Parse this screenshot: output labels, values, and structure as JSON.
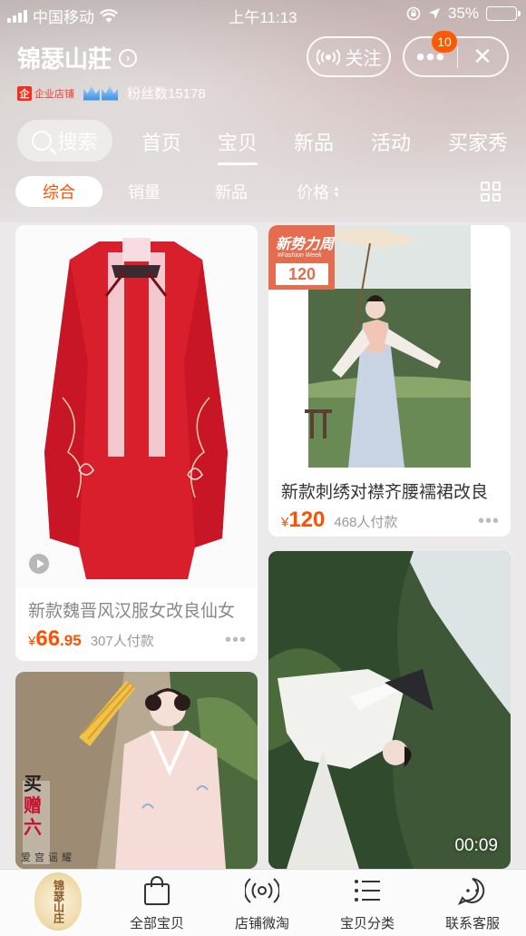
{
  "status_bar": {
    "carrier": "中国移动",
    "time": "上午11:13",
    "battery": "35%",
    "battery_level": 0.35
  },
  "shop": {
    "name": "锦瑟山莊",
    "follow_label": "关注",
    "badge_count": "10",
    "tmall_label": "企业店铺",
    "fans": "粉丝数15178",
    "logo_text": "锦瑟山庄"
  },
  "nav": {
    "search_label": "搜索",
    "tabs": [
      "首页",
      "宝贝",
      "新品",
      "活动",
      "买家秀"
    ],
    "active_tab": "宝贝"
  },
  "filters": {
    "items": [
      "综合",
      "销量",
      "新品",
      "价格"
    ],
    "active": "综合"
  },
  "products": [
    {
      "title": "新款魏晋风汉服女改良仙女",
      "currency": "¥",
      "price_int": "66",
      "price_dec": ".95",
      "sold": "307人付款"
    },
    {
      "title": "新款刺绣对襟齐腰襦裙改良",
      "currency": "¥",
      "price_int": "120",
      "price_dec": "",
      "sold": "468人付款",
      "tag": {
        "line1": "新势力周",
        "line2": "#Fashion Week",
        "price": "120"
      }
    },
    {
      "overlay_lines": [
        "买",
        "赠",
        "六"
      ],
      "side_text": "爱宫谣耀"
    },
    {
      "duration": "00:09"
    }
  ],
  "tabbar": {
    "items": [
      "全部宝贝",
      "店铺微淘",
      "宝贝分类",
      "联系客服"
    ]
  },
  "colors": {
    "accent": "#ff5000",
    "tmall_red": "#ff2a1a"
  }
}
